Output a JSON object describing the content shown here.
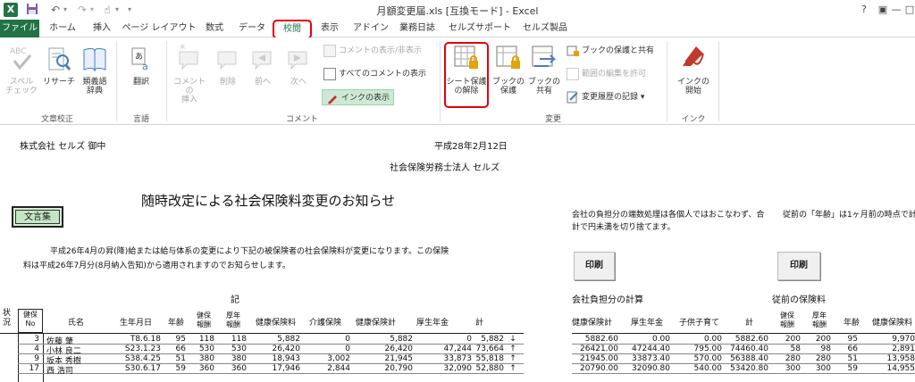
{
  "titlebar": {
    "title": "月額変更届.xls [互換モード] - Excel",
    "help": "?",
    "ribbon_options": "▣",
    "minimize": "—",
    "close": "□"
  },
  "tabs": [
    {
      "label": "ファイル"
    },
    {
      "label": "ホーム"
    },
    {
      "label": "挿入"
    },
    {
      "label": "ページ レイアウト"
    },
    {
      "label": "数式"
    },
    {
      "label": "データ"
    },
    {
      "label": "校閲"
    },
    {
      "label": "表示"
    },
    {
      "label": "アドイン"
    },
    {
      "label": "業務日誌"
    },
    {
      "label": "セルズサポート"
    },
    {
      "label": "セルズ製品"
    }
  ],
  "ribbon": {
    "proofing": {
      "group": "文章校正",
      "spell": "スペル\nチェック",
      "research": "リサーチ",
      "thesaurus": "類義語\n辞典"
    },
    "language": {
      "group": "言語",
      "translate": "翻訳"
    },
    "comments": {
      "group": "コメント",
      "insert": "コメントの\n挿入",
      "delete": "削除",
      "prev": "前へ",
      "next": "次へ",
      "show_hide": "コメントの表示/非表示",
      "show_all": "すべてのコメントの表示",
      "show_ink": "インクの表示"
    },
    "changes": {
      "group": "変更",
      "unprotect_sheet": "シート保護\nの解除",
      "protect_workbook": "ブックの\n保護",
      "share_workbook": "ブックの\n共有",
      "protect_share": "ブックの保護と共有",
      "allow_ranges": "範囲の編集を許可",
      "track_changes": "変更履歴の記録"
    },
    "ink": {
      "group": "インク",
      "start_inking": "インクの\n開始"
    }
  },
  "sheet": {
    "addressee": "株式会社 セルズ 御中",
    "date": "平成28年2月12日",
    "sender": "社会保険労務士法人 セルズ",
    "notice_title": "随時改定による社会保険料変更のお知らせ",
    "bunsho_button": "文言集",
    "body_line1": "平成26年4月の昇(降)給または給与体系の変更により下記の被保険者の社会保険料が変更になります。この保険",
    "body_line2": "料は平成26年7月分(8月納入告知)から適用されますのでお知らせします。",
    "note_right1": "会社の負担分の端数処理は各個人ではおこなわず、合",
    "note_right2": "計で円未満を切り捨てます。",
    "note_far_right": "従前の「年齢」は1ヶ月前の時点で計",
    "print_button_1": "印刷",
    "print_button_2": "印刷",
    "ki": "記",
    "company_calc": "会社負担分の計算",
    "prev_premium": "従前の保険料",
    "headers_left": {
      "status": "状\n況",
      "ins_no": "健保\nNo",
      "name": "氏名",
      "dob": "生年月日",
      "age": "年齢",
      "kenpo_grade": "健保\n報酬",
      "kosei_grade": "厚年\n報酬",
      "health_premium": "健康保険料",
      "care_premium": "介護保険",
      "health_total": "健康保険計",
      "pension": "厚生年金",
      "total": "計"
    },
    "headers_right": {
      "health_total": "健康保険計",
      "pension": "厚生年金",
      "child_care": "子供子育て",
      "total": "計",
      "kenpo_grade": "健保\n報酬",
      "kosei_grade": "厚年\n報酬",
      "age": "年齢",
      "health_premium": "健康保険料"
    },
    "rows": [
      {
        "no": "3",
        "name": "佐藤 肇",
        "dob": "T8.6.18",
        "age": "95",
        "kg": "118",
        "kog": "118",
        "hp": "5,882",
        "cp": "0",
        "ht": "5,882",
        "pen": "0",
        "tot": "5,882",
        "arrow": "↓",
        "r_ht": "5882.60",
        "r_pen": "0.00",
        "r_cc": "0.00",
        "r_tot": "5882.60",
        "r_kg": "200",
        "r_kog": "200",
        "r_age": "95",
        "r_hp": "9,970"
      },
      {
        "no": "4",
        "name": "小林 良二",
        "dob": "S23.1.23",
        "age": "66",
        "kg": "530",
        "kog": "530",
        "hp": "26,420",
        "cp": "0",
        "ht": "26,420",
        "pen": "47,244",
        "tot": "73,664",
        "arrow": "↑",
        "r_ht": "26421.00",
        "r_pen": "47244.40",
        "r_cc": "795.00",
        "r_tot": "74460.40",
        "r_kg": "58",
        "r_kog": "98",
        "r_age": "66",
        "r_hp": "2,891"
      },
      {
        "no": "9",
        "name": "坂本 秀樹",
        "dob": "S38.4.25",
        "age": "51",
        "kg": "380",
        "kog": "380",
        "hp": "18,943",
        "cp": "3,002",
        "ht": "21,945",
        "pen": "33,873",
        "tot": "55,818",
        "arrow": "↑",
        "r_ht": "21945.00",
        "r_pen": "33873.40",
        "r_cc": "570.00",
        "r_tot": "56388.40",
        "r_kg": "280",
        "r_kog": "280",
        "r_age": "51",
        "r_hp": "13,958"
      },
      {
        "no": "17",
        "name": "西 浩司",
        "dob": "S30.6.17",
        "age": "59",
        "kg": "360",
        "kog": "360",
        "hp": "17,946",
        "cp": "2,844",
        "ht": "20,790",
        "pen": "32,090",
        "tot": "52,880",
        "arrow": "↑",
        "r_ht": "20790.00",
        "r_pen": "32090.80",
        "r_cc": "540.00",
        "r_tot": "53420.80",
        "r_kg": "300",
        "r_kog": "300",
        "r_age": "59",
        "r_hp": "14,955"
      }
    ]
  }
}
